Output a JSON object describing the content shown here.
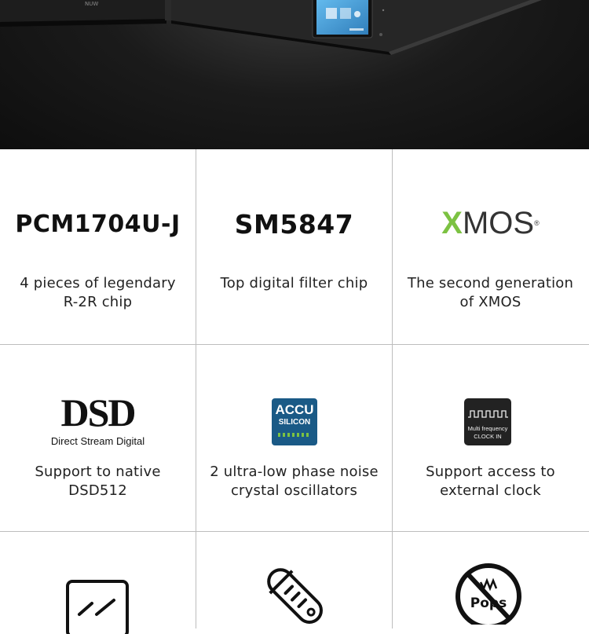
{
  "hero": {
    "device_brand": "NUW"
  },
  "features": [
    {
      "logo": "PCM1704U-J",
      "line1": "4 pieces of legendary",
      "line2": "R-2R chip"
    },
    {
      "logo": "SM5847",
      "line1": "Top digital filter chip",
      "line2": ""
    },
    {
      "logo_x": "X",
      "logo_rest": "MOS",
      "logo_reg": "®",
      "line1": "The second generation",
      "line2": "of XMOS"
    },
    {
      "logo_big": "DSD",
      "logo_sub": "Direct Stream Digital",
      "line1": "Support to native",
      "line2": "DSD512"
    },
    {
      "logo_top": "ACCU",
      "logo_bottom": "SILICON",
      "line1": "2 ultra-low phase noise",
      "line2": "crystal oscillators"
    },
    {
      "logo_line1": "Multi frequency",
      "logo_line2": "CLOCK IN",
      "line1": "Support access to",
      "line2": "external clock"
    },
    {
      "icon": "glass-panel-icon"
    },
    {
      "icon": "fuse-icon"
    },
    {
      "icon_text": "Pops"
    }
  ]
}
